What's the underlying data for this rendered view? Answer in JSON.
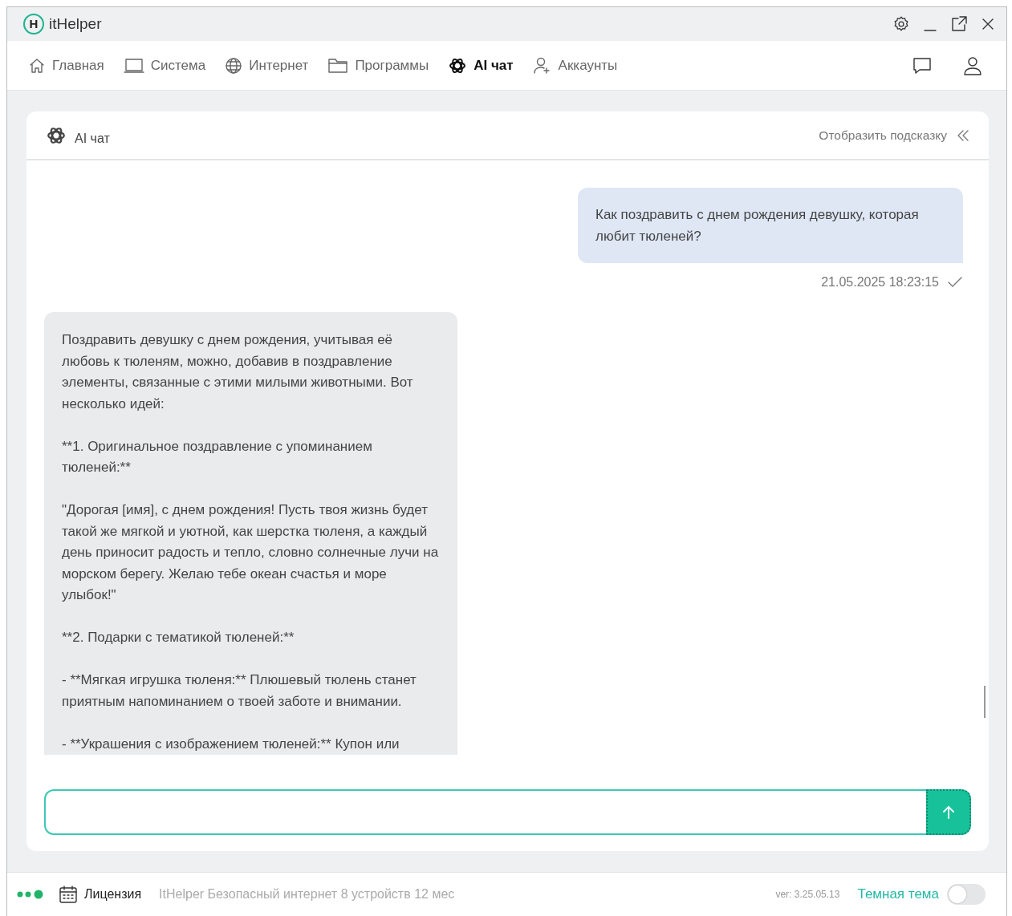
{
  "window": {
    "title": "itHelper",
    "logo_letter": "H"
  },
  "nav": [
    {
      "label": "Главная",
      "selected": false
    },
    {
      "label": "Система",
      "selected": false
    },
    {
      "label": "Интернет",
      "selected": false
    },
    {
      "label": "Программы",
      "selected": false
    },
    {
      "label": "AI чат",
      "selected": true
    },
    {
      "label": "Аккаунты",
      "selected": false
    }
  ],
  "chat": {
    "title": "AI чат",
    "hint_toggle": "Отобразить подсказку",
    "messages": [
      {
        "kind": "user",
        "paragraphs": [
          "Как поздравить с днем рождения девушку, которая любит тюленей?"
        ],
        "time": "21.05.2025 18:23:15"
      },
      {
        "kind": "assistant",
        "paragraphs": [
          "Поздравить девушку с днем рождения, учитывая её любовь к тюленям, можно, добавив в поздравление элементы, связанные с этими милыми животными. Вот несколько идей:",
          "**1. Оригинальное поздравление с упоминанием тюленей:**",
          "\"Дорогая [имя], с днем рождения! Пусть твоя жизнь будет такой же мягкой и уютной, как шерстка тюленя, а каждый день приносит радость и тепло, словно солнечные лучи на морском берегу. Желаю тебе океан счастья и море улыбок!\"",
          "**2. Подарки с тематикой тюленей:**",
          "- **Мягкая игрушка тюленя:** Плюшевый тюлень станет приятным напоминанием о твоей заботе и внимании.",
          "- **Украшения с изображением тюленей:** Купон или"
        ]
      }
    ]
  },
  "status_bar": {
    "license_label": "Лицензия",
    "license_text": "ItHelper Безопасный интернет 8 устройств 12 мес",
    "version": "ver: 3.25.05.13",
    "theme_toggle": {
      "label": "Темная тема",
      "on": false
    }
  }
}
